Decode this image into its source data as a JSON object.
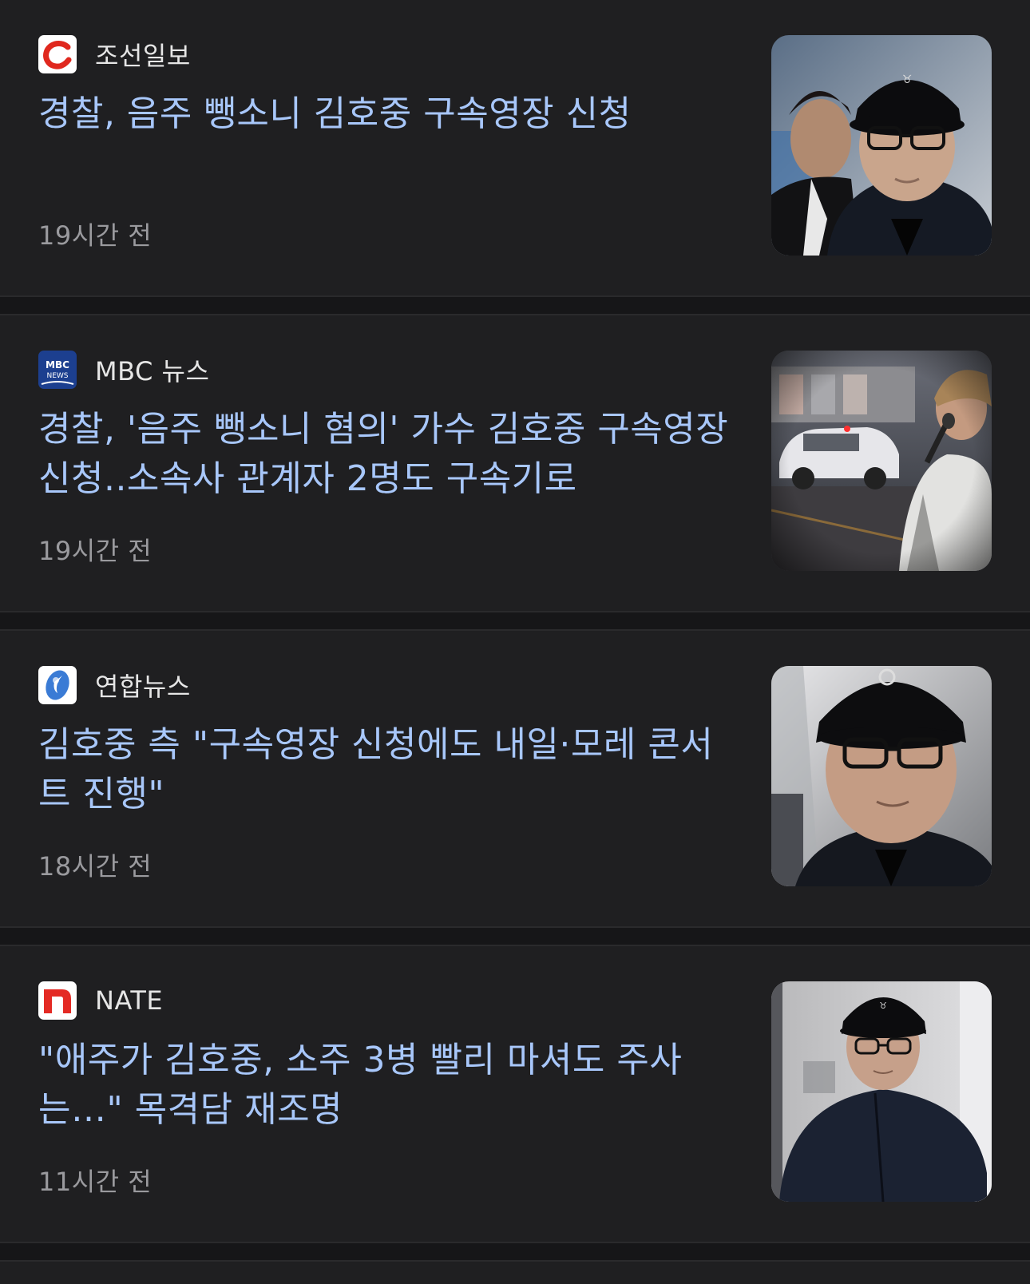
{
  "articles": [
    {
      "source": "조선일보",
      "source_logo": "chosun-logo-icon",
      "headline": "경찰, 음주 뺑소니 김호중 구속영장 신청",
      "time": "19시간 전",
      "thumbnail": "man-in-black-cap-and-glasses-with-bodyguard"
    },
    {
      "source": "MBC 뉴스",
      "source_logo": "mbc-news-logo-icon",
      "headline": "경찰, '음주 뺑소니 혐의' 가수 김호중 구속영장 신청..소속사 관계자 2명도 구속기로",
      "time": "19시간 전",
      "thumbnail": "car-on-street-and-singer-with-microphone"
    },
    {
      "source": "연합뉴스",
      "source_logo": "yonhap-logo-icon",
      "headline": "김호중 측 \"구속영장 신청에도 내일·모레 콘서트 진행\"",
      "time": "18시간 전",
      "thumbnail": "man-in-black-cap-and-glasses-closeup"
    },
    {
      "source": "NATE",
      "source_logo": "nate-logo-icon",
      "headline": "\"애주가 김호중, 소주 3병 빨리 마셔도 주사는…\" 목격담 재조명",
      "time": "11시간 전",
      "thumbnail": "man-in-black-cap-walking"
    }
  ],
  "colors": {
    "background": "#1f1f21",
    "headline": "#a8c7fa",
    "source_text": "#e6e6e6",
    "time_text": "#9a9a9e",
    "separator": "#161618"
  }
}
